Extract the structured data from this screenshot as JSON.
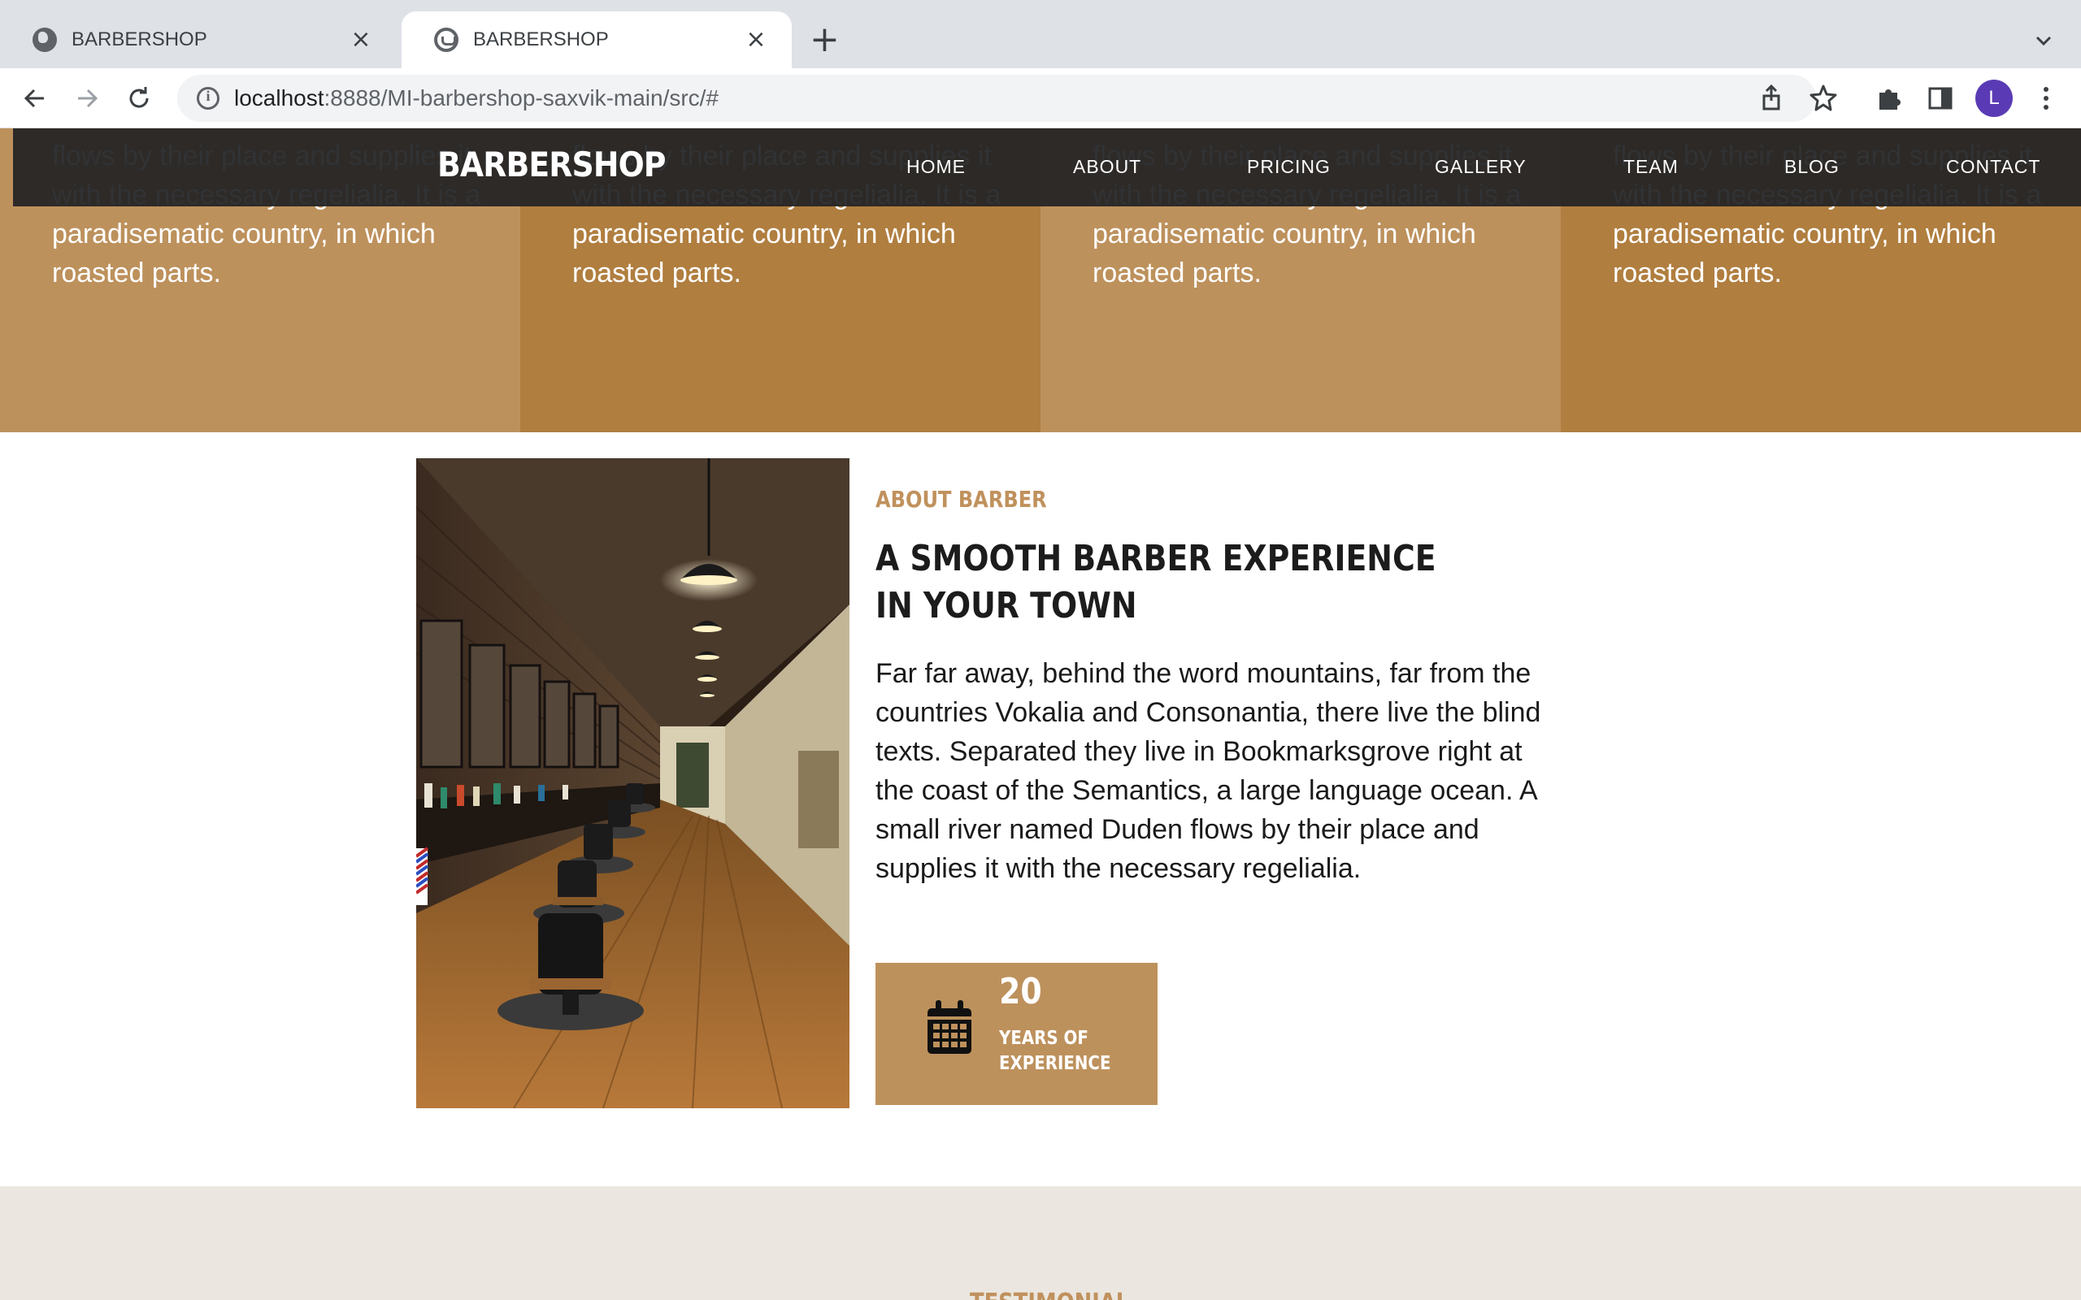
{
  "browser": {
    "tabs": [
      {
        "title": "BARBERSHOP",
        "active": false,
        "favicon": "globe-icon"
      },
      {
        "title": "BARBERSHOP",
        "active": true,
        "favicon": "barbershop-favicon"
      }
    ],
    "url_host": "localhost",
    "url_path": ":8888/MI-barbershop-saxvik-main/src/#",
    "profile_initial": "L"
  },
  "services": [
    {
      "text": "flows by their place and supplies it with the necessary regelialia. It is a paradisematic country, in which roasted parts."
    },
    {
      "text": "flows by their place and supplies it with the necessary regelialia. It is a paradisematic country, in which roasted parts."
    },
    {
      "text": "flows by their place and supplies it with the necessary regelialia. It is a paradisematic country, in which roasted parts."
    },
    {
      "text": "flows by their place and supplies it with the necessary regelialia. It is a paradisematic country, in which roasted parts."
    }
  ],
  "navbar": {
    "brand": "BARBERSHOP",
    "links": [
      "HOME",
      "ABOUT",
      "PRICING",
      "GALLERY",
      "TEAM",
      "BLOG",
      "CONTACT"
    ]
  },
  "about": {
    "eyebrow": "ABOUT BARBER",
    "headline_line1": "A SMOOTH BARBER EXPERIENCE",
    "headline_line2": "IN YOUR TOWN",
    "body": "Far far away, behind the word mountains, far from the countries Vokalia and Consonantia, there live the blind texts. Separated they live in Bookmarksgrove right at the coast of the Semantics, a large language ocean. A small river named Duden flows by their place and supplies it with the necessary regelialia.",
    "stat_number": "20",
    "stat_label": "YEARS OF EXPERIENCE"
  },
  "testimonial": {
    "label": "TESTIMONIAL"
  },
  "colors": {
    "accent": "#bd915c",
    "accent_dark": "#b07e3f",
    "navbar": "#212225",
    "section_bg": "#ebe6df"
  }
}
